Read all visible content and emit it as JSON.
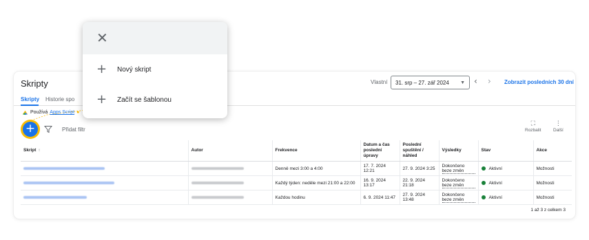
{
  "header": {
    "title": "Skripty",
    "range_label": "Vlastní",
    "range_value": "31. srp – 27. zář 2024",
    "show_last": "Zobrazit posledních 30 dní"
  },
  "tabs": [
    {
      "label": "Skripty",
      "active": true
    },
    {
      "label": "Historie spo"
    }
  ],
  "apps_notice": {
    "prefix": "Používá",
    "link": "Apps Script"
  },
  "toolbar": {
    "add_filter": "Přidat filtr",
    "expand": "Rozbalit",
    "more": "Další"
  },
  "table": {
    "columns": [
      "Skript",
      "Autor",
      "Frekvence",
      "Datum a čas poslední úpravy",
      "Poslední spuštění / náhled",
      "Výsledky",
      "Stav",
      "Akce"
    ],
    "rows": [
      {
        "frequency": "Denně mezi 3:00 a 4:00",
        "modified": "17. 7. 2024 12:21",
        "last_run": "27. 9. 2024 3:25",
        "result": "Dokončeno beze změn",
        "status": "Aktivní",
        "action": "Možnosti"
      },
      {
        "frequency": "Každý týden: neděle mezi 21:00 a 22:00",
        "modified": "16. 9. 2024 13:17",
        "last_run": "22. 9. 2024 21:18",
        "result": "Dokončeno beze změn",
        "status": "Aktivní",
        "action": "Možnosti"
      },
      {
        "frequency": "Každou hodinu",
        "modified": "6. 9. 2024 11:47",
        "last_run": "27. 9. 2024 13:48",
        "result": "Dokončeno beze změn",
        "status": "Aktivní",
        "action": "Možnosti"
      }
    ]
  },
  "pagination": "1 až 3 z celkem 3",
  "popup": {
    "items": [
      "Nový skript",
      "Začít se šablonou"
    ]
  },
  "colors": {
    "accent": "#1a73e8",
    "status_active": "#188038",
    "highlight": "#fbbc04"
  }
}
